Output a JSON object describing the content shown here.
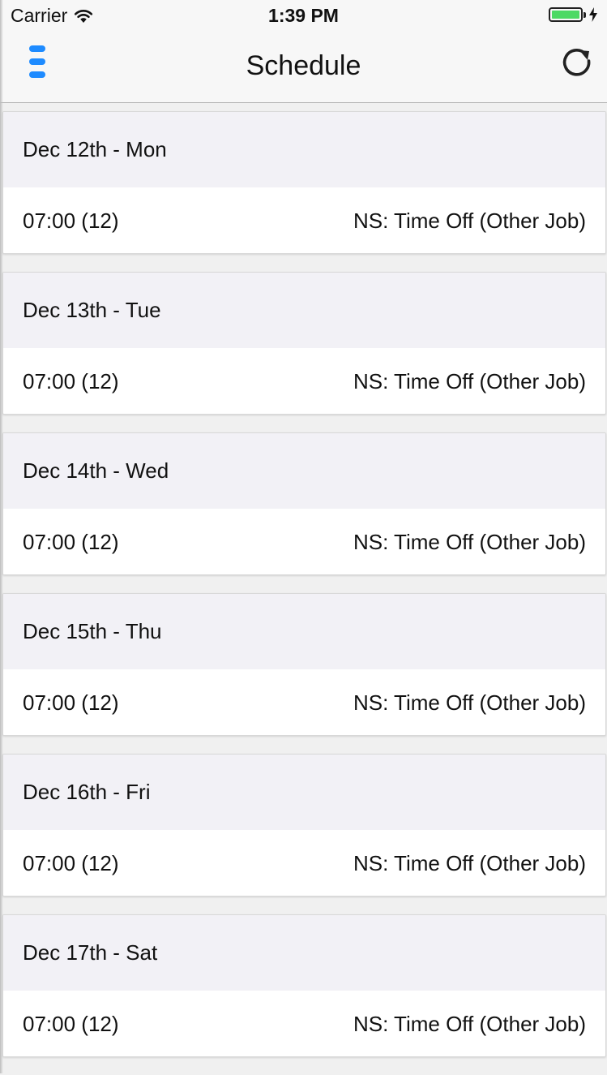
{
  "status_bar": {
    "carrier": "Carrier",
    "time": "1:39 PM",
    "battery_level": 1.0,
    "icons": [
      "wifi-icon",
      "battery-icon",
      "charging-bolt-icon"
    ]
  },
  "nav": {
    "title": "Schedule",
    "left_icon": "menu-icon",
    "right_icon": "refresh-icon",
    "accent_color": "#1e8bff"
  },
  "days": [
    {
      "date": "Dec 12th - Mon",
      "time": "07:00 (12)",
      "status": "NS: Time Off (Other Job)"
    },
    {
      "date": "Dec 13th - Tue",
      "time": "07:00 (12)",
      "status": "NS: Time Off (Other Job)"
    },
    {
      "date": "Dec 14th - Wed",
      "time": "07:00 (12)",
      "status": "NS: Time Off (Other Job)"
    },
    {
      "date": "Dec 15th - Thu",
      "time": "07:00 (12)",
      "status": "NS: Time Off (Other Job)"
    },
    {
      "date": "Dec 16th - Fri",
      "time": "07:00 (12)",
      "status": "NS: Time Off (Other Job)"
    },
    {
      "date": "Dec 17th - Sat",
      "time": "07:00 (12)",
      "status": "NS: Time Off (Other Job)"
    }
  ]
}
